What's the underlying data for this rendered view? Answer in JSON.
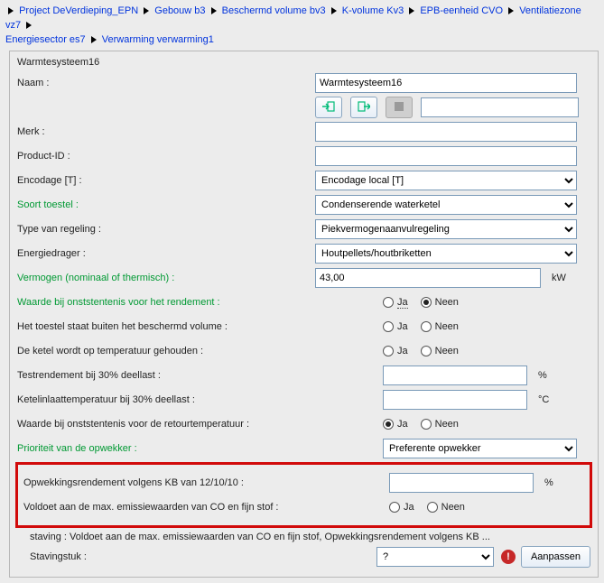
{
  "breadcrumb": [
    "Project DeVerdieping_EPN",
    "Gebouw b3",
    "Beschermd volume bv3",
    "K-volume Kv3",
    "EPB-eenheid CVO",
    "Ventilatiezone vz7",
    "Energiesector es7",
    "Verwarming verwarming1"
  ],
  "section_title": "Warmtesysteem16",
  "labels": {
    "naam": "Naam :",
    "merk": "Merk :",
    "product_id": "Product-ID :",
    "encodage": "Encodage [T] :",
    "soort": "Soort toestel :",
    "type_regeling": "Type van regeling :",
    "energiedrager": "Energiedrager :",
    "vermogen": "Vermogen (nominaal of thermisch) :",
    "waarde_rendement": "Waarde bij onststentenis voor het rendement :",
    "buiten_vol": "Het toestel staat buiten het beschermd volume :",
    "ketel_temp": "De ketel wordt op temperatuur gehouden :",
    "testrendement": "Testrendement bij 30% deellast :",
    "ketelinlaat": "Ketelinlaattemperatuur bij 30% deellast :",
    "waarde_retour": "Waarde bij onststentenis voor de retourtemperatuur :",
    "prioriteit": "Prioriteit van de opwekker :",
    "opwekking": "Opwekkingsrendement volgens KB van 12/10/10 :",
    "voldoet": "Voldoet aan de max. emissiewaarden van CO en fijn stof :",
    "staving": "staving : Voldoet aan de max. emissiewaarden van CO en fijn stof, Opwekkingsrendement volgens KB ...",
    "stavingstuk": "Stavingstuk :"
  },
  "values": {
    "naam": "Warmtesysteem16",
    "merk": "",
    "product_id": "",
    "encodage": "Encodage local [T]",
    "soort": "Condenserende waterketel",
    "type_regeling": "Piekvermogenaanvulregeling",
    "energiedrager": "Houtpellets/houtbriketten",
    "vermogen": "43,00",
    "testrendement": "",
    "ketelinlaat": "",
    "prioriteit": "Preferente opwekker",
    "opwekking": "",
    "stavingstuk": "?"
  },
  "units": {
    "kw": "kW",
    "pct": "%",
    "degc": "°C"
  },
  "radio": {
    "ja": "Ja",
    "neen": "Neen"
  },
  "buttons": {
    "aanpassen": "Aanpassen"
  },
  "radios_state": {
    "waarde_rendement": "neen",
    "buiten_vol": "",
    "ketel_temp": "",
    "waarde_retour": "ja",
    "voldoet": ""
  }
}
